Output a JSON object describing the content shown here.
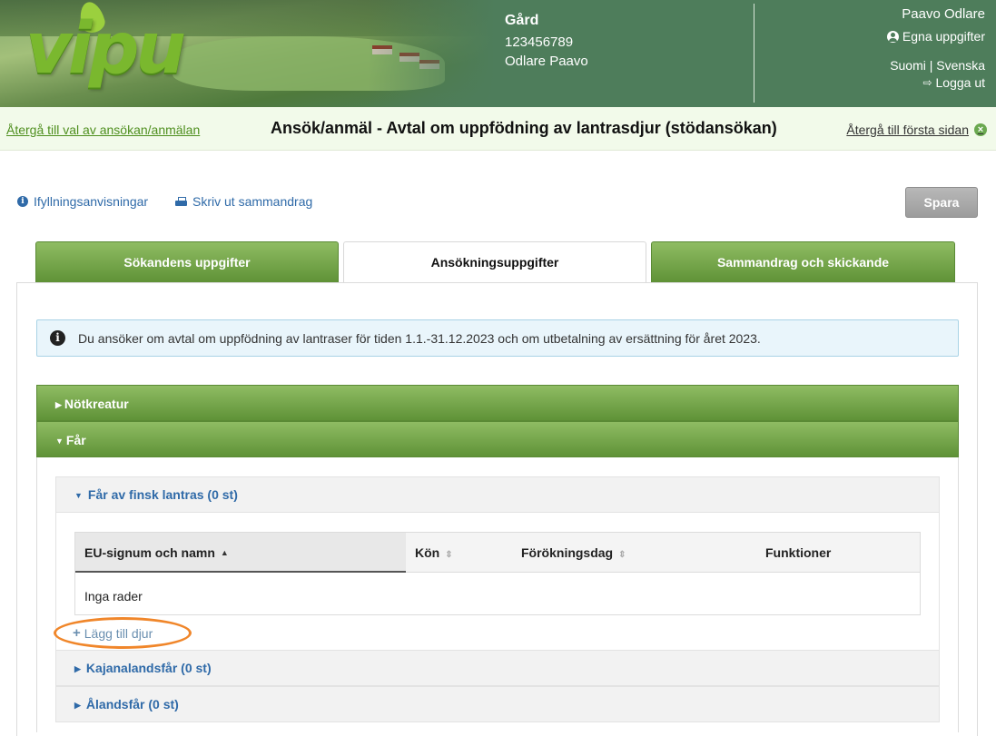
{
  "header": {
    "logo_text": "vipu",
    "farm_title": "Gård",
    "farm_id": "123456789",
    "farm_owner": "Odlare Paavo",
    "user_name": "Paavo Odlare",
    "own_info_link": "Egna uppgifter",
    "lang_fi": "Suomi",
    "lang_sep": "|",
    "lang_sv": "Svenska",
    "logout": "Logga ut"
  },
  "subheader": {
    "back_link": "Återgå till val av ansökan/anmälan",
    "title": "Ansök/anmäl - Avtal om uppfödning av lantrasdjur (stödansökan)",
    "front_link": "Återgå till första sidan"
  },
  "tools": {
    "instructions": "Ifyllningsanvisningar",
    "print_summary": "Skriv ut sammandrag",
    "save": "Spara"
  },
  "tabs": [
    {
      "label": "Sökandens uppgifter",
      "active": false
    },
    {
      "label": "Ansökningsuppgifter",
      "active": true
    },
    {
      "label": "Sammandrag och skickande",
      "active": false
    }
  ],
  "info_text": "Du ansöker om avtal om uppfödning av lantraser för tiden 1.1.-31.12.2023 och om utbetalning av ersättning för året 2023.",
  "sections": [
    {
      "label": "Nötkreatur",
      "expanded": false
    },
    {
      "label": "Får",
      "expanded": true
    }
  ],
  "subsections": [
    {
      "label": "Får av finsk lantras (0 st)",
      "expanded": true
    },
    {
      "label": "Kajanalandsfår (0 st)",
      "expanded": false
    },
    {
      "label": "Ålandsfår (0 st)",
      "expanded": false
    }
  ],
  "table": {
    "columns": [
      "EU-signum och namn",
      "Kön",
      "Förökningsdag",
      "Funktioner"
    ],
    "empty_text": "Inga rader"
  },
  "add_animal": "Lägg till djur",
  "colors": {
    "header_green": "#4e7d5b",
    "tab_green": "#5f9237",
    "link_blue": "#2f6aa8",
    "highlight_orange": "#f0862a"
  }
}
